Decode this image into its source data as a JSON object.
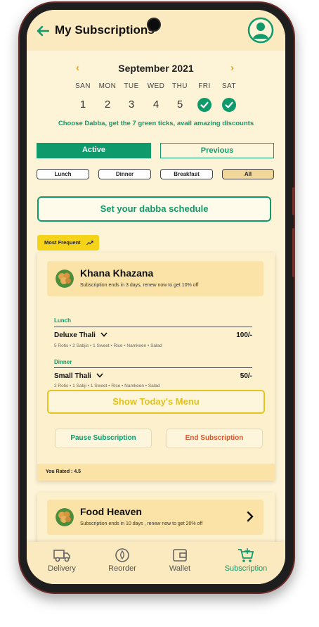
{
  "header": {
    "title": "My Subscriptions"
  },
  "calendar": {
    "month": "September 2021",
    "days": [
      {
        "name": "SAN",
        "num": "1",
        "ticked": false
      },
      {
        "name": "MON",
        "num": "2",
        "ticked": false
      },
      {
        "name": "TUE",
        "num": "3",
        "ticked": false
      },
      {
        "name": "WED",
        "num": "4",
        "ticked": false
      },
      {
        "name": "THU",
        "num": "5",
        "ticked": false
      },
      {
        "name": "FRI",
        "num": "",
        "ticked": true
      },
      {
        "name": "SAT",
        "num": "",
        "ticked": true
      }
    ],
    "hint": "Choose Dabba, get the 7 green ticks, avail amazing discounts"
  },
  "tabs": {
    "active": "Active",
    "previous": "Previous"
  },
  "filters": [
    "Lunch",
    "Dinner",
    "Breakfast",
    "All"
  ],
  "filter_selected": "All",
  "schedule_button": "Set your dabba schedule",
  "badge": "Most Frequent",
  "subscriptions": [
    {
      "name": "Khana Khazana",
      "note": "Subscription ends in 3 days, renew now to get 10% off",
      "lunch": {
        "label": "Lunch",
        "item": "Deluxe Thali",
        "price": "100/-",
        "desc": "5 Rotis • 2 Sabjis • 1 Sweet • Rice • Namkeen • Salad"
      },
      "dinner": {
        "label": "Dinner",
        "item": "Small Thali",
        "price": "50/-",
        "desc": "2 Rotis • 1 Sabji • 1 Sweet • Rice • Namkeen • Salad"
      },
      "menu_button": "Show Today's Menu",
      "pause_button": "Pause Subscription",
      "end_button": "End Subscription",
      "rating": "You Rated :  4.5"
    },
    {
      "name": "Food Heaven",
      "note": "Subscription ends in 10 days , renew now to get 20% off"
    }
  ],
  "bottom_nav": [
    {
      "label": "Delivery",
      "icon": "truck-icon"
    },
    {
      "label": "Reorder",
      "icon": "reorder-icon"
    },
    {
      "label": "Wallet",
      "icon": "wallet-icon"
    },
    {
      "label": "Subscription",
      "icon": "cart-icon"
    }
  ],
  "colors": {
    "green": "#0f9a6b",
    "yellow": "#e8c31d",
    "cream": "#fdf3d6",
    "end_red": "#e0542a"
  }
}
